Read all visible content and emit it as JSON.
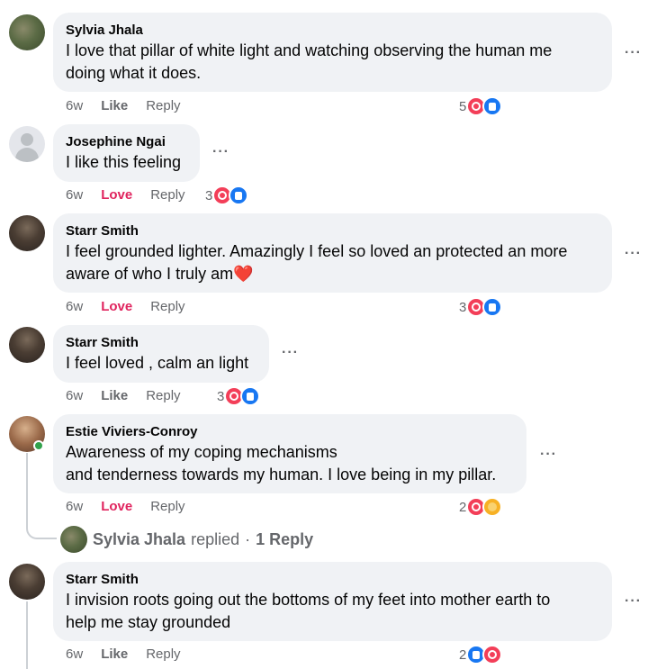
{
  "comments": [
    {
      "author": "Sylvia Jhala",
      "lines": [
        "I love that pillar of white light and watching observing the human me",
        "doing what it does."
      ],
      "time": "6w",
      "action": "Like",
      "reply": "Reply",
      "reaction_count": "5",
      "reactions": [
        "love-icon",
        "like-icon"
      ]
    },
    {
      "author": "Josephine Ngai",
      "lines": [
        "I like this feeling"
      ],
      "time": "6w",
      "action": "Love",
      "reply": "Reply",
      "reaction_count": "3",
      "reactions": [
        "love-icon",
        "like-icon"
      ]
    },
    {
      "author": "Starr Smith",
      "lines": [
        "I feel grounded lighter. Amazingly I feel so loved an protected an more",
        "aware of who I truly am❤️"
      ],
      "time": "6w",
      "action": "Love",
      "reply": "Reply",
      "reaction_count": "3",
      "reactions": [
        "love-icon",
        "like-icon"
      ]
    },
    {
      "author": "Starr Smith",
      "lines": [
        "I feel loved , calm an light"
      ],
      "time": "6w",
      "action": "Like",
      "reply": "Reply",
      "reaction_count": "3",
      "reactions": [
        "love-icon",
        "like-icon"
      ]
    },
    {
      "author": "Estie Viviers-Conroy",
      "lines": [
        "Awareness of my coping mechanisms",
        "and tenderness towards my human. I love being in my pillar."
      ],
      "time": "6w",
      "action": "Love",
      "reply": "Reply",
      "reaction_count": "2",
      "reactions": [
        "love-icon",
        "care-icon"
      ]
    },
    {
      "author": "Starr Smith",
      "lines": [
        "I invision roots going out the bottoms of my feet into mother earth to",
        "help me stay grounded"
      ],
      "time": "6w",
      "action": "Like",
      "reply": "Reply",
      "reaction_count": "2",
      "reactions": [
        "like-icon",
        "love-icon"
      ]
    }
  ],
  "replied_summary": {
    "name": "Sylvia Jhala",
    "verb": "replied",
    "separator": "·",
    "count": "1 Reply"
  },
  "more_label": "···",
  "colors": {
    "bubble": "#f0f2f5",
    "love_action": "#e0245e",
    "meta_text": "#65676b",
    "love_icon": "#f33e58",
    "like_icon": "#1877f2",
    "care_icon": "#f7b125"
  }
}
